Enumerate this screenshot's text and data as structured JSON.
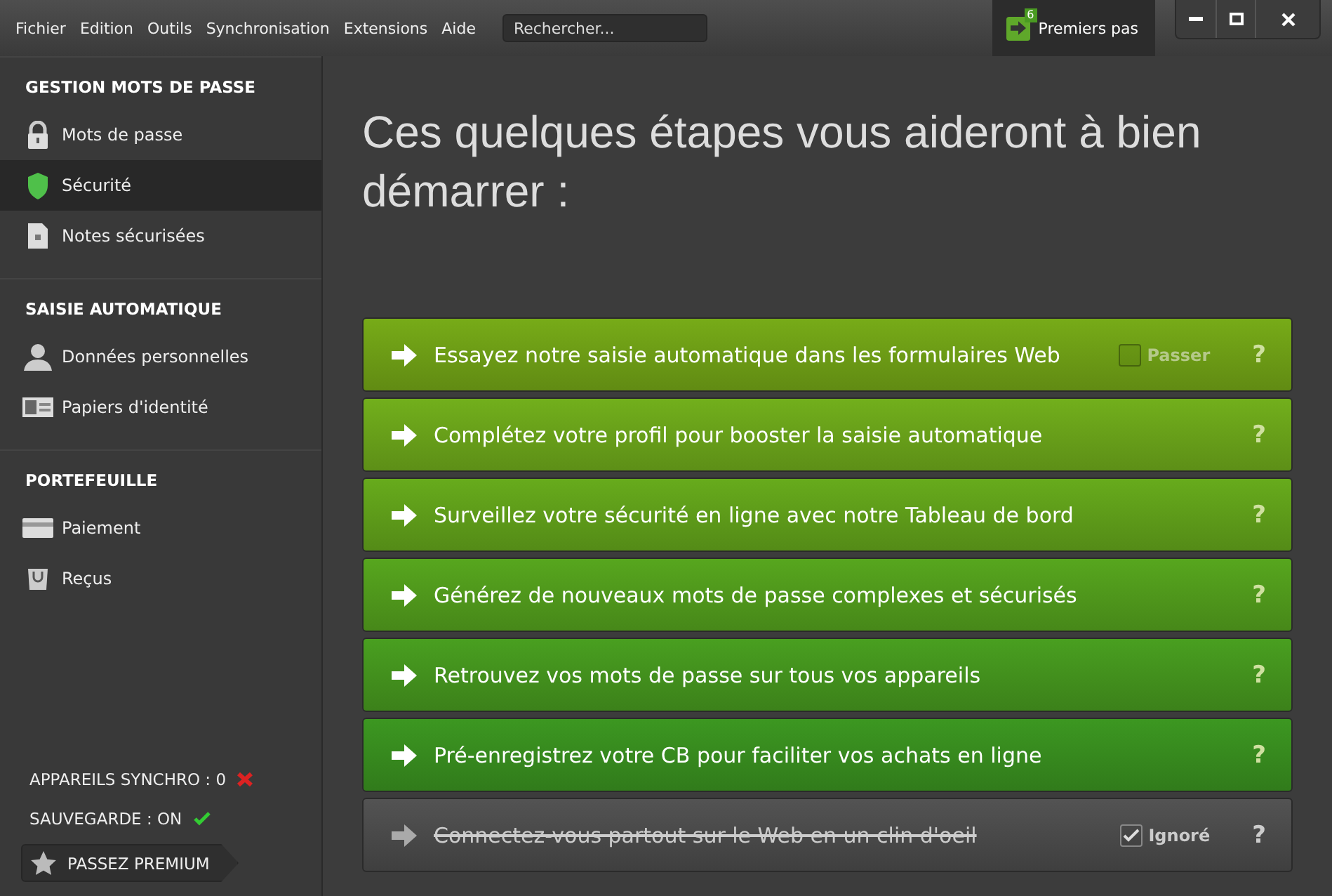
{
  "menu": [
    "Fichier",
    "Edition",
    "Outils",
    "Synchronisation",
    "Extensions",
    "Aide"
  ],
  "search": {
    "placeholder": "Rechercher..."
  },
  "getting_started": {
    "label": "Premiers pas",
    "badge": "6",
    "selected": true
  },
  "sidebar": {
    "sections": [
      {
        "title": "GESTION MOTS DE PASSE",
        "items": [
          {
            "label": "Mots de passe",
            "kind": "lock",
            "selected": false
          },
          {
            "label": "Sécurité",
            "kind": "shield",
            "selected": true
          },
          {
            "label": "Notes sécurisées",
            "kind": "note",
            "selected": false
          }
        ]
      },
      {
        "title": "SAISIE AUTOMATIQUE",
        "items": [
          {
            "label": "Données personnelles",
            "kind": "person",
            "selected": false
          },
          {
            "label": "Papiers d'identité",
            "kind": "idcard",
            "selected": false
          }
        ]
      },
      {
        "title": "PORTEFEUILLE",
        "items": [
          {
            "label": "Paiement",
            "kind": "card",
            "selected": false
          },
          {
            "label": "Reçus",
            "kind": "bag",
            "selected": false
          }
        ]
      }
    ],
    "status": [
      {
        "label": "APPAREILS SYNCHRO : 0",
        "ok": false
      },
      {
        "label": "SAUVEGARDE : ON",
        "ok": true
      }
    ],
    "premium_button": "PASSEZ PREMIUM"
  },
  "heading": "Ces quelques étapes vous aideront à bien démarrer :",
  "steps": [
    {
      "label": "Essayez notre saisie automatique dans les formulaires Web",
      "color": "#6e9e16",
      "ignored": false,
      "skip": {
        "label": "Passer",
        "checked": false
      },
      "help": "?"
    },
    {
      "label": "Complétez votre profil pour booster la saisie automatique",
      "color": "#6aa21a",
      "ignored": false,
      "help": "?"
    },
    {
      "label": "Surveillez votre sécurité en ligne avec notre Tableau de bord",
      "color": "#5f9e1a",
      "ignored": false,
      "help": "?"
    },
    {
      "label": "Générez de nouveaux mots de passe complexes et sécurisés",
      "color": "#519a1c",
      "ignored": false,
      "help": "?"
    },
    {
      "label": "Retrouvez vos mots de passe sur tous vos appareils",
      "color": "#44931e",
      "ignored": false,
      "help": "?"
    },
    {
      "label": "Pré-enregistrez votre CB pour faciliter vos achats en ligne",
      "color": "#388c1f",
      "ignored": false,
      "help": "?"
    },
    {
      "label": "Connectez-vous partout sur le Web en un clin d'oeil",
      "color": "#4a4a4a",
      "ignored": true,
      "skip": {
        "label": "Ignoré",
        "checked": true
      },
      "help": "?"
    }
  ]
}
